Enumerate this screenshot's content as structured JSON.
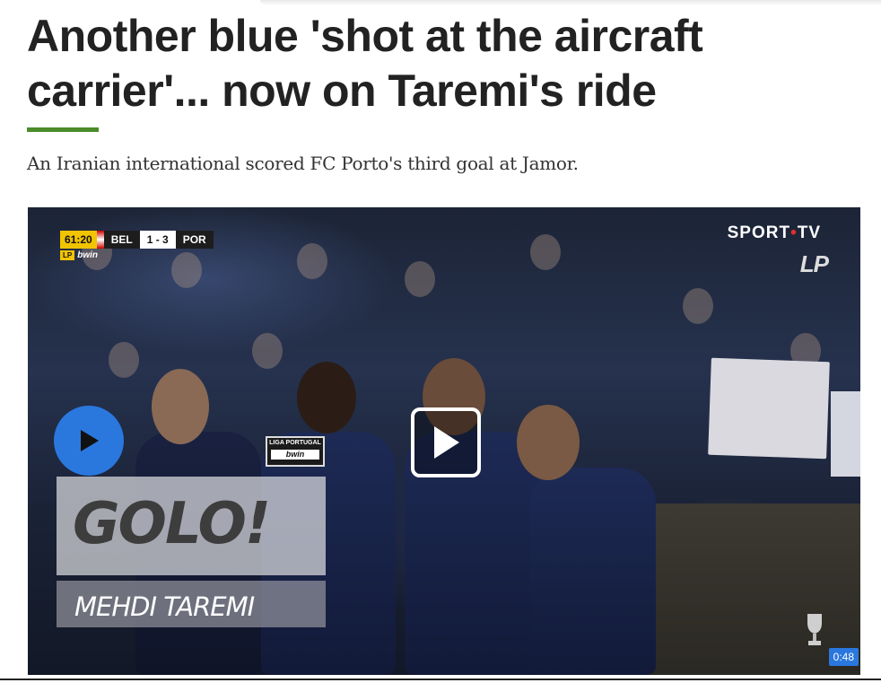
{
  "article": {
    "headline": "Another blue 'shot at the aircraft carrier'... now on Taremi's ride",
    "subtitle": "An Iranian international scored FC Porto's third goal at Jamor.",
    "accent_color": "#4a8c2a"
  },
  "video": {
    "scorebug": {
      "time": "61:20",
      "home": "BEL",
      "score": "1 - 3",
      "away": "POR",
      "badge": "LP",
      "sponsor": "bwin"
    },
    "broadcaster_part1": "SPORT",
    "broadcaster_dot": "•",
    "broadcaster_part2": "TV",
    "league_logo": "LP",
    "liga_badge_line1": "LIGA PORTUGAL",
    "liga_badge_line2": "bwin",
    "overlay_title": "GOLO!",
    "overlay_player": "MEHDI TAREMI",
    "duration": "0:48",
    "play_icon": "play-icon",
    "play_color": "#2a78de"
  }
}
